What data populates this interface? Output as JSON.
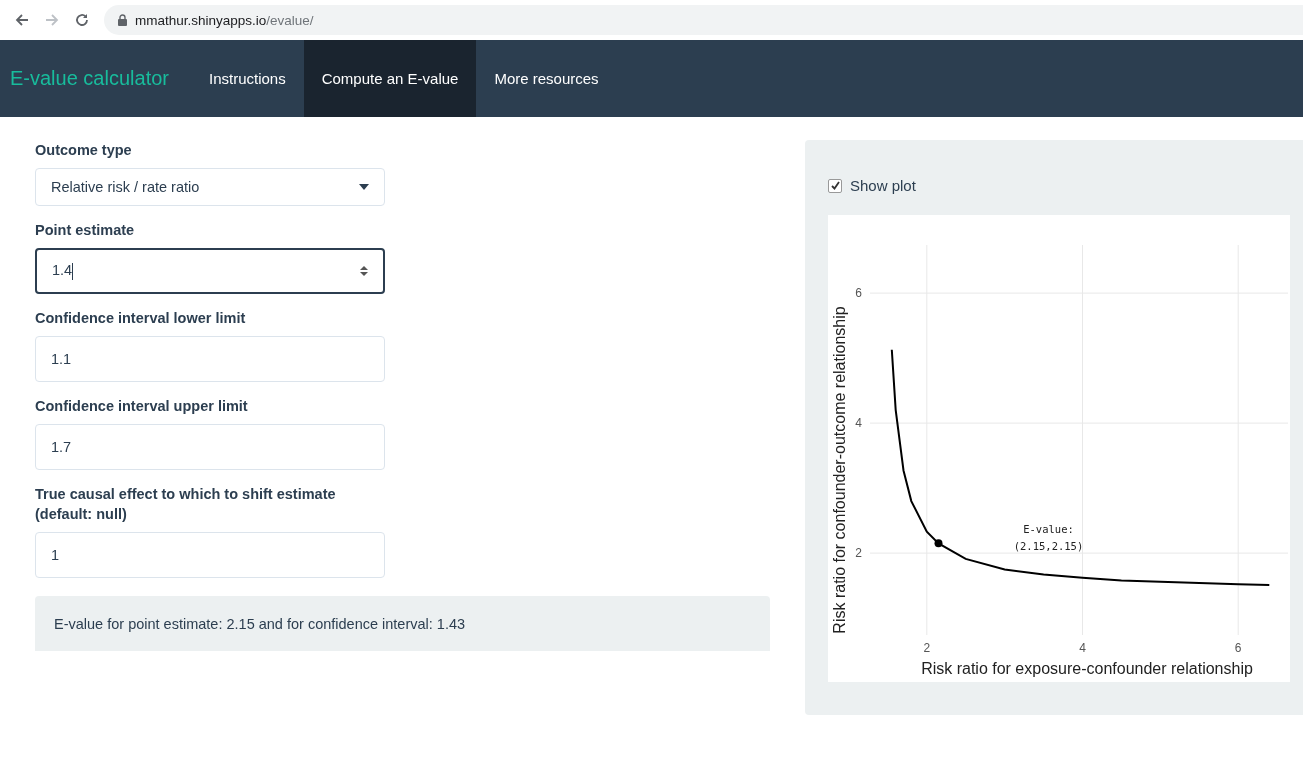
{
  "browser": {
    "url_host": "mmathur.shinyapps.io",
    "url_path": "/evalue/"
  },
  "navbar": {
    "brand": "E-value calculator",
    "tabs": [
      {
        "label": "Instructions",
        "selected": false
      },
      {
        "label": "Compute an E-value",
        "selected": true
      },
      {
        "label": "More resources",
        "selected": false
      }
    ]
  },
  "form": {
    "fields": [
      {
        "kind": "select",
        "label": "Outcome type",
        "value": "Relative risk / rate ratio",
        "focused": false
      },
      {
        "kind": "number",
        "label": "Point estimate",
        "value": "1.4",
        "focused": true
      },
      {
        "kind": "text",
        "label": "Confidence interval lower limit",
        "value": "1.1",
        "focused": false
      },
      {
        "kind": "text",
        "label": "Confidence interval upper limit",
        "value": "1.7",
        "focused": false
      },
      {
        "kind": "text",
        "label": "True causal effect to which to shift estimate (default: null)",
        "value": "1",
        "focused": false
      }
    ],
    "result": "E-value for point estimate: 2.15 and for confidence interval: 1.43"
  },
  "plot_panel": {
    "show_plot": {
      "label": "Show plot",
      "checked": true
    },
    "chart_data": {
      "type": "line",
      "xlabel": "Risk ratio for exposure-confounder relationship",
      "ylabel": "Risk ratio for confounder-outcome relationship",
      "grid": true,
      "xlim": [
        1.27,
        6.64
      ],
      "ylim": [
        0.74,
        6.74
      ],
      "xticks": [
        2,
        4,
        6
      ],
      "yticks": [
        2,
        4,
        6
      ],
      "series": [
        {
          "color": "#000000",
          "x": [
            1.55,
            1.6,
            1.7,
            1.8,
            2.0,
            2.15,
            2.5,
            3,
            3.5,
            4,
            4.5,
            5,
            5.5,
            6,
            6.4
          ],
          "values": [
            5.13,
            4.2,
            3.27,
            2.8,
            2.33,
            2.15,
            1.91,
            1.75,
            1.67,
            1.62,
            1.58,
            1.56,
            1.54,
            1.52,
            1.51
          ]
        },
        {
          "color": "#000000",
          "marker": true,
          "x": [
            2.15
          ],
          "values": [
            2.15
          ]
        }
      ],
      "annotations": [
        "E-value:\n(2.15,2.15)"
      ]
    }
  }
}
